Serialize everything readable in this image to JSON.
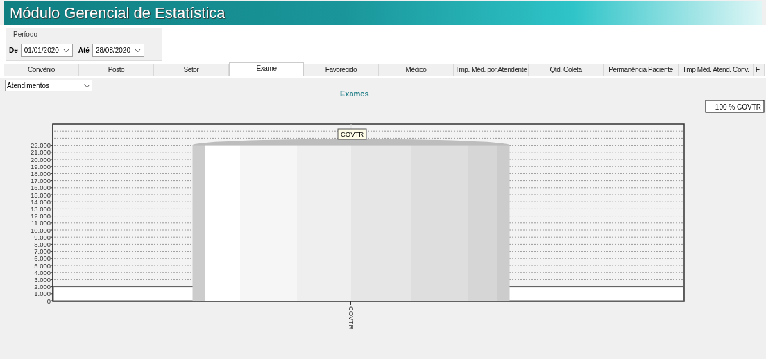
{
  "window": {
    "title": "Módulo Gerencial de Estatística"
  },
  "period": {
    "label": "Período",
    "from": {
      "label": "De",
      "value": "01/01/2020"
    },
    "to": {
      "label": "Até",
      "value": "28/08/2020"
    }
  },
  "tabs": [
    {
      "label": "Convênio",
      "selected": false
    },
    {
      "label": "Posto",
      "selected": false
    },
    {
      "label": "Setor",
      "selected": false
    },
    {
      "label": "Exame",
      "selected": true
    },
    {
      "label": "Favorecido",
      "selected": false
    },
    {
      "label": "Médico",
      "selected": false
    },
    {
      "label": "Tmp. Méd. por Atendente",
      "selected": false
    },
    {
      "label": "Qtd. Coleta",
      "selected": false
    },
    {
      "label": "Permanência Paciente",
      "selected": false
    },
    {
      "label": "Tmp Méd. Atend. Conv.",
      "selected": false
    },
    {
      "label": "F",
      "selected": false
    }
  ],
  "metric_select": {
    "value": "Atendimentos"
  },
  "chart": {
    "legend": "100 % COVTR",
    "point_label": "COVTR",
    "chart_data": {
      "type": "bar",
      "title": "Exames",
      "categories": [
        "COVTR"
      ],
      "values": [
        22000
      ],
      "ylim": [
        0,
        25000
      ],
      "grid": true,
      "bands": [
        {
          "axis": "y",
          "from": 0,
          "to": 2000,
          "color": "#ffffff"
        }
      ],
      "yticks": [
        {
          "value": 0,
          "label": "0"
        },
        {
          "value": 1000,
          "label": "1.000"
        },
        {
          "value": 2000,
          "label": "2.000"
        },
        {
          "value": 3000,
          "label": "3.000"
        },
        {
          "value": 4000,
          "label": "4.000"
        },
        {
          "value": 5000,
          "label": "5.000"
        },
        {
          "value": 6000,
          "label": "6.000"
        },
        {
          "value": 7000,
          "label": "7.000"
        },
        {
          "value": 8000,
          "label": "8.000"
        },
        {
          "value": 9000,
          "label": "9.000"
        },
        {
          "value": 10000,
          "label": "10.000"
        },
        {
          "value": 11000,
          "label": "11.000"
        },
        {
          "value": 12000,
          "label": "12.000"
        },
        {
          "value": 13000,
          "label": "13.000"
        },
        {
          "value": 14000,
          "label": "14.000"
        },
        {
          "value": 15000,
          "label": "15.000"
        },
        {
          "value": 16000,
          "label": "16.000"
        },
        {
          "value": 17000,
          "label": "17.000"
        },
        {
          "value": 18000,
          "label": "18.000"
        },
        {
          "value": 19000,
          "label": "19.000"
        },
        {
          "value": 20000,
          "label": "20.000"
        },
        {
          "value": 21000,
          "label": "21.000"
        },
        {
          "value": 22000,
          "label": "22.000"
        }
      ]
    }
  }
}
